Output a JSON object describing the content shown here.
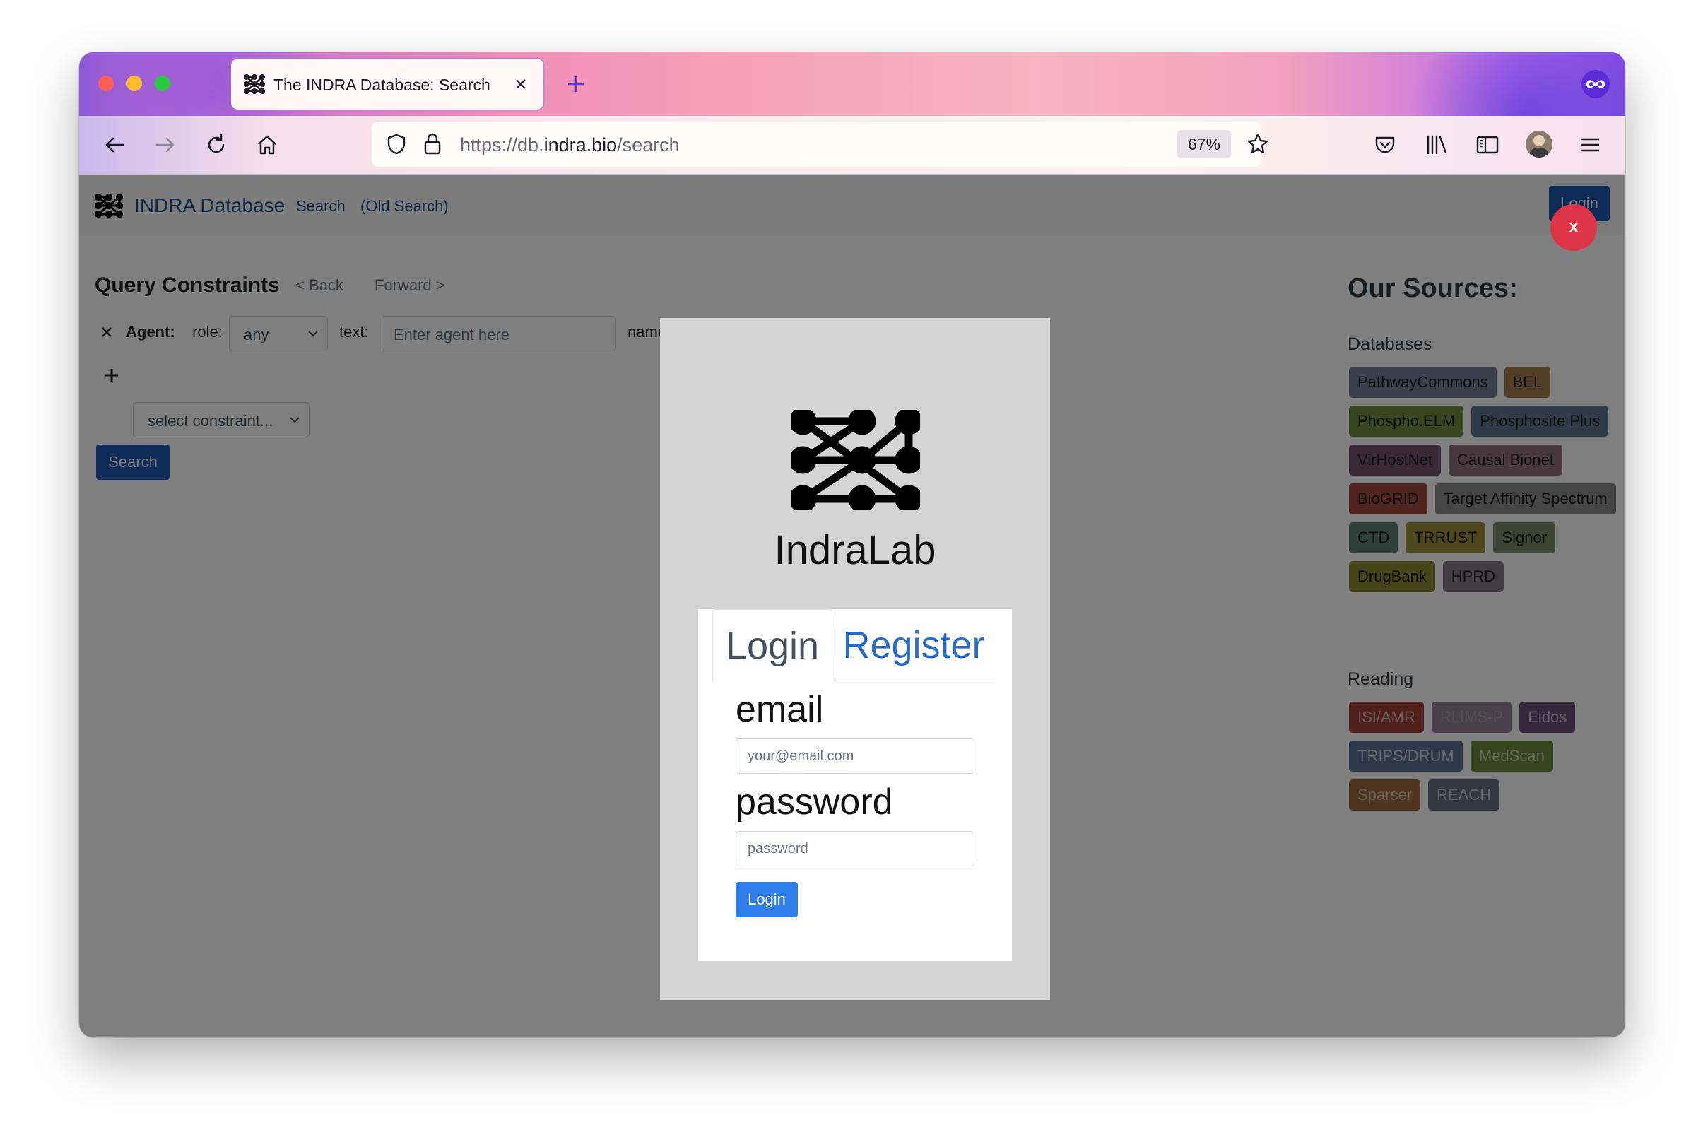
{
  "browser": {
    "tab_title": "The INDRA Database: Search",
    "url_scheme": "https://db.",
    "url_host": "indra.bio",
    "url_path": "/search",
    "zoom": "67%"
  },
  "site_nav": {
    "brand": "INDRA Database",
    "links": [
      "Search",
      "(Old Search)"
    ],
    "login_label": "Login",
    "close_label": "x"
  },
  "query": {
    "title": "Query Constraints",
    "back_label": "< Back",
    "forward_label": "Forward >",
    "agent_label": "Agent:",
    "role_label": "role:",
    "role_value": "any",
    "text_label": "text:",
    "text_placeholder": "Enter agent here",
    "namespace_label": "namesp",
    "constraint_placeholder": "select constraint...",
    "search_label": "Search"
  },
  "sources": {
    "title": "Our Sources:",
    "databases_heading": "Databases",
    "databases": [
      {
        "name": "PathwayCommons",
        "color": "#7a7c96"
      },
      {
        "name": "BEL",
        "color": "#a47d4c"
      },
      {
        "name": "Phospho.ELM",
        "color": "#6e8c3d"
      },
      {
        "name": "Phosphosite Plus",
        "color": "#5e7491"
      },
      {
        "name": "VirHostNet",
        "color": "#73506c"
      },
      {
        "name": "Causal Bionet",
        "color": "#8d7079"
      },
      {
        "name": "BioGRID",
        "color": "#a04b3e"
      },
      {
        "name": "Target Affinity Spectrum",
        "color": "#8a8a8a"
      },
      {
        "name": "CTD",
        "color": "#5e7e75"
      },
      {
        "name": "TRRUST",
        "color": "#9c8d3c"
      },
      {
        "name": "Signor",
        "color": "#7d8667"
      },
      {
        "name": "DrugBank",
        "color": "#8d8a33"
      },
      {
        "name": "HPRD",
        "color": "#877a86"
      }
    ],
    "reading_heading": "Reading",
    "reading": [
      {
        "name": "ISI/AMR",
        "color": "#a3413a",
        "text_color": "#d5b8b5"
      },
      {
        "name": "RLIMS-P",
        "color": "#93838f",
        "text_color": "#a89aa5"
      },
      {
        "name": "Eidos",
        "color": "#6b4f79",
        "text_color": "#cfc4d3"
      },
      {
        "name": "TRIPS/DRUM",
        "color": "#5b7290",
        "text_color": "#cbd3de"
      },
      {
        "name": "MedScan",
        "color": "#6c883f",
        "text_color": "#c8d2b4"
      },
      {
        "name": "Sparser",
        "color": "#9c6a3f",
        "text_color": "#d8c3ad"
      },
      {
        "name": "REACH",
        "color": "#6a6d80",
        "text_color": "#c8c9d2"
      }
    ]
  },
  "modal": {
    "brand": "IndraLab",
    "tab_login": "Login",
    "tab_register": "Register",
    "email_label": "email",
    "email_placeholder": "your@email.com",
    "password_label": "password",
    "password_placeholder": "password",
    "login_button": "Login"
  }
}
